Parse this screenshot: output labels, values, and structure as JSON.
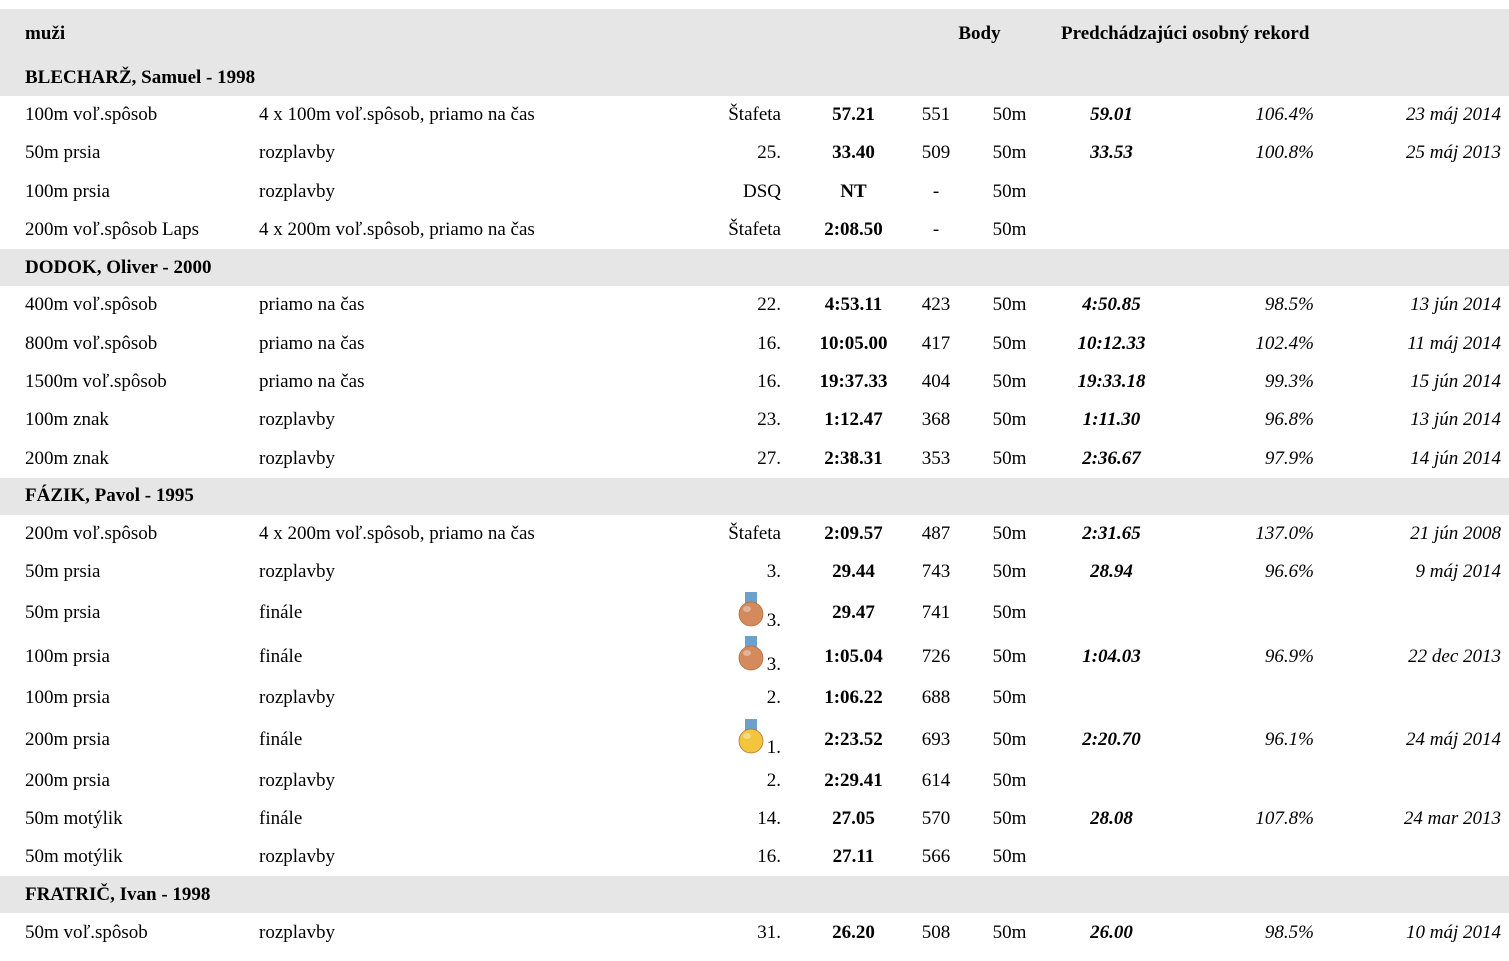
{
  "header": {
    "category": "muži",
    "points_label": "Body",
    "pb_label": "Predchádzajúci osobný rekord"
  },
  "colors": {
    "header_bg": "#e6e6e6",
    "bronze": "#d48a5c",
    "gold": "#f2c53d",
    "ribbon": "#6fa0c8"
  },
  "swimmers": [
    {
      "name": "BLECHARŽ, Samuel - 1998",
      "results": [
        {
          "event": "100m voľ.spôsob",
          "round": "4 x 100m voľ.spôsob, priamo na čas",
          "place": "Štafeta",
          "medal": "",
          "time": "57.21",
          "points": "551",
          "pool": "50m",
          "pb": "59.01",
          "pct": "106.4%",
          "date": "23 máj 2014"
        },
        {
          "event": "50m prsia",
          "round": "rozplavby",
          "place": "25.",
          "medal": "",
          "time": "33.40",
          "points": "509",
          "pool": "50m",
          "pb": "33.53",
          "pct": "100.8%",
          "date": "25 máj 2013"
        },
        {
          "event": "100m prsia",
          "round": "rozplavby",
          "place": "DSQ",
          "medal": "",
          "time": "NT",
          "points": "-",
          "pool": "50m",
          "pb": "",
          "pct": "",
          "date": ""
        },
        {
          "event": "200m voľ.spôsob Laps",
          "round": "4 x 200m voľ.spôsob, priamo na čas",
          "place": "Štafeta",
          "medal": "",
          "time": "2:08.50",
          "points": "-",
          "pool": "50m",
          "pb": "",
          "pct": "",
          "date": ""
        }
      ]
    },
    {
      "name": "DODOK, Oliver - 2000",
      "results": [
        {
          "event": "400m voľ.spôsob",
          "round": "priamo na čas",
          "place": "22.",
          "medal": "",
          "time": "4:53.11",
          "points": "423",
          "pool": "50m",
          "pb": "4:50.85",
          "pct": "98.5%",
          "date": "13 jún 2014"
        },
        {
          "event": "800m voľ.spôsob",
          "round": "priamo na čas",
          "place": "16.",
          "medal": "",
          "time": "10:05.00",
          "points": "417",
          "pool": "50m",
          "pb": "10:12.33",
          "pct": "102.4%",
          "date": "11 máj 2014"
        },
        {
          "event": "1500m voľ.spôsob",
          "round": "priamo na čas",
          "place": "16.",
          "medal": "",
          "time": "19:37.33",
          "points": "404",
          "pool": "50m",
          "pb": "19:33.18",
          "pct": "99.3%",
          "date": "15 jún 2014"
        },
        {
          "event": "100m znak",
          "round": "rozplavby",
          "place": "23.",
          "medal": "",
          "time": "1:12.47",
          "points": "368",
          "pool": "50m",
          "pb": "1:11.30",
          "pct": "96.8%",
          "date": "13 jún 2014"
        },
        {
          "event": "200m znak",
          "round": "rozplavby",
          "place": "27.",
          "medal": "",
          "time": "2:38.31",
          "points": "353",
          "pool": "50m",
          "pb": "2:36.67",
          "pct": "97.9%",
          "date": "14 jún 2014"
        }
      ]
    },
    {
      "name": "FÁZIK, Pavol - 1995",
      "results": [
        {
          "event": "200m voľ.spôsob",
          "round": "4 x 200m voľ.spôsob, priamo na čas",
          "place": "Štafeta",
          "medal": "",
          "time": "2:09.57",
          "points": "487",
          "pool": "50m",
          "pb": "2:31.65",
          "pct": "137.0%",
          "date": "21 jún 2008"
        },
        {
          "event": "50m prsia",
          "round": "rozplavby",
          "place": "3.",
          "medal": "",
          "time": "29.44",
          "points": "743",
          "pool": "50m",
          "pb": "28.94",
          "pct": "96.6%",
          "date": "9 máj 2014"
        },
        {
          "event": "50m prsia",
          "round": "finále",
          "place": "3.",
          "medal": "bronze",
          "time": "29.47",
          "points": "741",
          "pool": "50m",
          "pb": "",
          "pct": "",
          "date": ""
        },
        {
          "event": "100m prsia",
          "round": "finále",
          "place": "3.",
          "medal": "bronze",
          "time": "1:05.04",
          "points": "726",
          "pool": "50m",
          "pb": "1:04.03",
          "pct": "96.9%",
          "date": "22 dec 2013"
        },
        {
          "event": "100m prsia",
          "round": "rozplavby",
          "place": "2.",
          "medal": "",
          "time": "1:06.22",
          "points": "688",
          "pool": "50m",
          "pb": "",
          "pct": "",
          "date": ""
        },
        {
          "event": "200m prsia",
          "round": "finále",
          "place": "1.",
          "medal": "gold",
          "time": "2:23.52",
          "points": "693",
          "pool": "50m",
          "pb": "2:20.70",
          "pct": "96.1%",
          "date": "24 máj 2014"
        },
        {
          "event": "200m prsia",
          "round": "rozplavby",
          "place": "2.",
          "medal": "",
          "time": "2:29.41",
          "points": "614",
          "pool": "50m",
          "pb": "",
          "pct": "",
          "date": ""
        },
        {
          "event": "50m motýlik",
          "round": "finále",
          "place": "14.",
          "medal": "",
          "time": "27.05",
          "points": "570",
          "pool": "50m",
          "pb": "28.08",
          "pct": "107.8%",
          "date": "24 mar 2013"
        },
        {
          "event": "50m motýlik",
          "round": "rozplavby",
          "place": "16.",
          "medal": "",
          "time": "27.11",
          "points": "566",
          "pool": "50m",
          "pb": "",
          "pct": "",
          "date": ""
        }
      ]
    },
    {
      "name": "FRATRIČ, Ivan - 1998",
      "results": [
        {
          "event": "50m voľ.spôsob",
          "round": "rozplavby",
          "place": "31.",
          "medal": "",
          "time": "26.20",
          "points": "508",
          "pool": "50m",
          "pb": "26.00",
          "pct": "98.5%",
          "date": "10 máj 2014"
        }
      ]
    }
  ]
}
